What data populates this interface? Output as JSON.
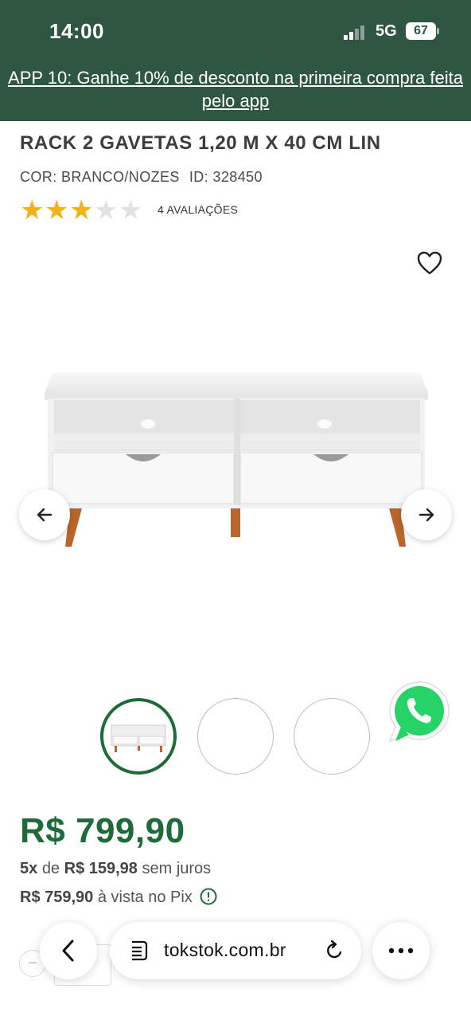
{
  "status_bar": {
    "time": "14:00",
    "network": "5G",
    "battery": "67"
  },
  "promo": {
    "text": "APP 10: Ganhe 10% de desconto na primeira compra feita pelo app"
  },
  "product": {
    "title": "RACK 2 GAVETAS 1,20 M X 40 CM LIN",
    "color_label": "COR: BRANCO/NOZES",
    "id_label": "ID: 328450",
    "rating": {
      "value": 3,
      "max": 5,
      "count_label": "4 AVALIAÇÕES"
    },
    "thumbnails_count": 3,
    "active_thumbnail": 1
  },
  "pricing": {
    "price": "R$ 799,90",
    "installments_count": "5x",
    "installments_de": "de",
    "installments_value": "R$ 159,98",
    "installments_suffix": "sem juros",
    "pix_value": "R$ 759,90",
    "pix_suffix": "à vista no Pix"
  },
  "browser": {
    "url": "tokstok.com.br"
  },
  "quantity": {
    "minus_symbol": "−"
  },
  "icons": {
    "favorite": "heart-outline-icon",
    "prev": "arrow-left-icon",
    "next": "arrow-right-icon",
    "chat": "whatsapp-icon",
    "info": "info-icon",
    "back": "chevron-left-icon",
    "page": "page-lines-icon",
    "reload": "reload-icon",
    "more": "more-dots-icon"
  },
  "colors": {
    "brand_green": "#2f5640",
    "price_green": "#1e6b3a",
    "star_on": "#f2b21a",
    "star_off": "#e2e2e2",
    "whatsapp": "#25d366"
  }
}
